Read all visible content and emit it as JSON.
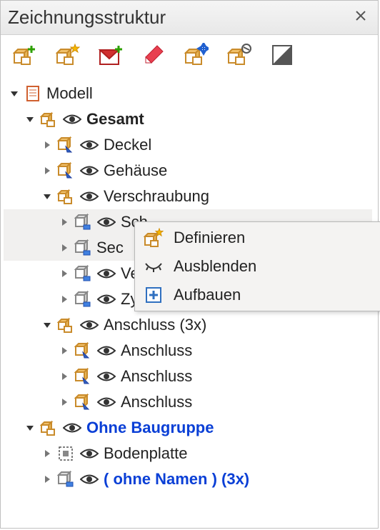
{
  "panel": {
    "title": "Zeichnungsstruktur"
  },
  "toolbar": {
    "btn_new_group": "new-group",
    "btn_new_group2": "new-group-star",
    "btn_new_view": "new-view",
    "btn_edit": "edit",
    "btn_move": "move-node",
    "btn_renumber": "renumber",
    "btn_contrast": "display-toggle"
  },
  "tree": {
    "model": "Modell",
    "gesamt": "Gesamt",
    "deckel": "Deckel",
    "gehaeuse": "Gehäuse",
    "verschraubung": "Verschraubung",
    "sch": "Sch",
    "sec": "Sec",
    "vers": "Vers",
    "zyli": "Zyli",
    "anschluss_group": "Anschluss (3x)",
    "anschluss": "Anschluss",
    "ohne_baugruppe": "Ohne Baugruppe",
    "bodenplatte": "Bodenplatte",
    "ohne_namen": "( ohne Namen )  (3x)"
  },
  "context_menu": {
    "definieren": "Definieren",
    "ausblenden": "Ausblenden",
    "aufbauen": "Aufbauen"
  }
}
